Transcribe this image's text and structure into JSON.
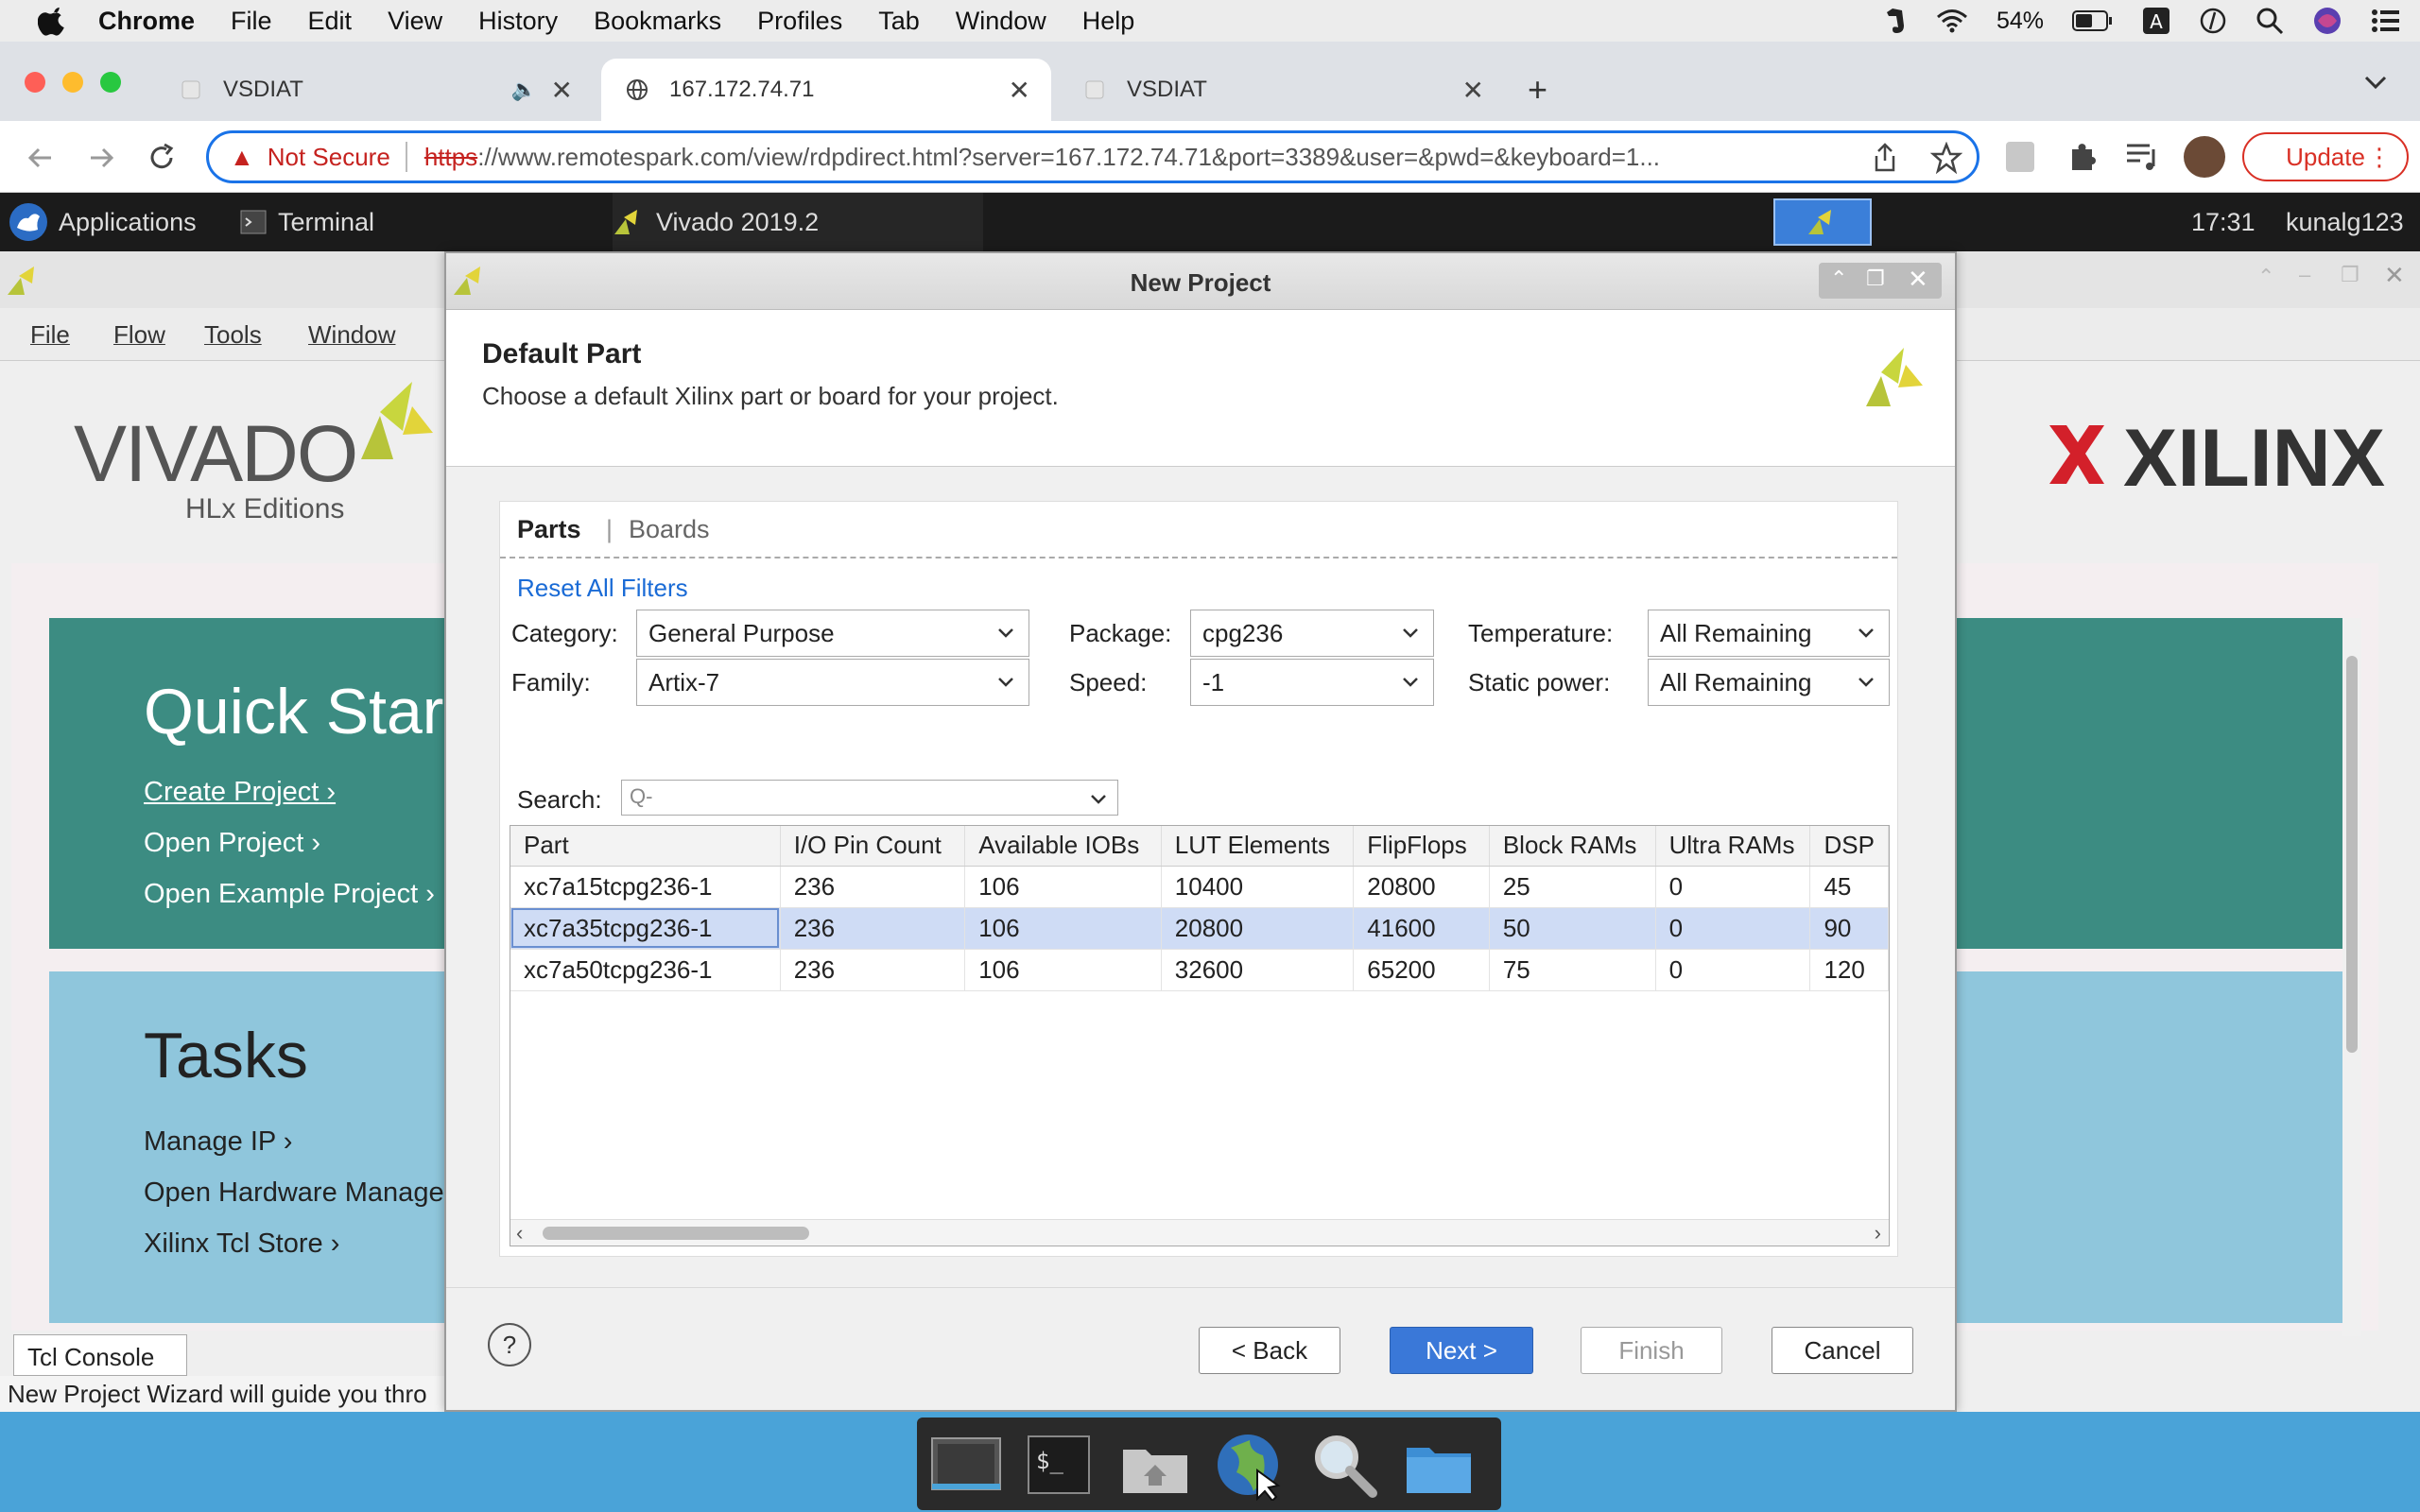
{
  "macos_menubar": {
    "app": "Chrome",
    "items": [
      "File",
      "Edit",
      "View",
      "History",
      "Bookmarks",
      "Profiles",
      "Tab",
      "Window",
      "Help"
    ],
    "battery": "54%"
  },
  "browser": {
    "tabs": [
      {
        "label": "VSDIAT"
      },
      {
        "label": "167.172.74.71"
      },
      {
        "label": "VSDIAT"
      }
    ],
    "address": {
      "security": "Not Secure",
      "scheme": "https",
      "rest": "://www.remotespark.com/view/rdpdirect.html?server=167.172.74.71&port=3389&user=&pwd=&keyboard=1..."
    },
    "update_label": "Update"
  },
  "remote_taskbar": {
    "applications": "Applications",
    "terminal": "Terminal",
    "vivado": "Vivado 2019.2",
    "time": "17:31",
    "user": "kunalg123"
  },
  "vivado": {
    "menu": [
      "File",
      "Flow",
      "Tools",
      "Window"
    ],
    "logo_vivado": "VIVADO",
    "logo_sub": "HLx Editions",
    "logo_xilinx": "XILINX",
    "quick_start": {
      "title": "Quick Start",
      "links": [
        "Create Project",
        "Open Project",
        "Open Example Project"
      ]
    },
    "tasks": {
      "title": "Tasks",
      "links": [
        "Manage IP",
        "Open Hardware Manager",
        "Xilinx Tcl Store"
      ]
    },
    "tcl_console": "Tcl Console",
    "status_text": "New Project Wizard will guide you thro"
  },
  "dialog": {
    "title": "New Project",
    "heading": "Default Part",
    "subheading": "Choose a default Xilinx part or board for your project.",
    "tabs": {
      "parts": "Parts",
      "boards": "Boards"
    },
    "reset_filters": "Reset All Filters",
    "filters": {
      "category": {
        "label": "Category:",
        "value": "General Purpose"
      },
      "family": {
        "label": "Family:",
        "value": "Artix-7"
      },
      "package": {
        "label": "Package:",
        "value": "cpg236"
      },
      "speed": {
        "label": "Speed:",
        "value": "-1"
      },
      "temperature": {
        "label": "Temperature:",
        "value": "All Remaining"
      },
      "static_power": {
        "label": "Static power:",
        "value": "All Remaining"
      }
    },
    "search_label": "Search:",
    "search_placeholder": "Q-",
    "columns": [
      "Part",
      "I/O Pin Count",
      "Available IOBs",
      "LUT Elements",
      "FlipFlops",
      "Block RAMs",
      "Ultra RAMs",
      "DSP"
    ],
    "rows": [
      [
        "xc7a15tcpg236-1",
        "236",
        "106",
        "10400",
        "20800",
        "25",
        "0",
        "45"
      ],
      [
        "xc7a35tcpg236-1",
        "236",
        "106",
        "20800",
        "41600",
        "50",
        "0",
        "90"
      ],
      [
        "xc7a50tcpg236-1",
        "236",
        "106",
        "32600",
        "65200",
        "75",
        "0",
        "120"
      ]
    ],
    "selected_row": 1,
    "buttons": {
      "help": "?",
      "back": "< Back",
      "next": "Next >",
      "finish": "Finish",
      "cancel": "Cancel"
    }
  }
}
